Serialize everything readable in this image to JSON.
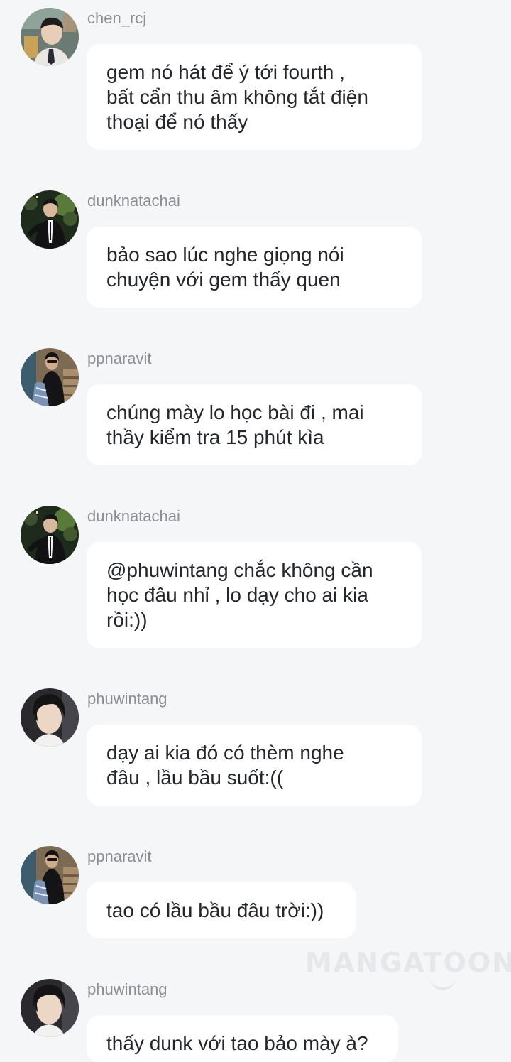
{
  "messages": [
    {
      "user": "chen_rcj",
      "text": "gem nó hát để ý tới fourth ,\nbất cẩn thu âm không tắt điện\nthoại để nó thấy",
      "avatar": "avatar-chen-icon"
    },
    {
      "user": "dunknatachai",
      "text": "bảo sao lúc nghe giọng nói\nchuyện với gem thấy quen",
      "avatar": "avatar-dunk-icon"
    },
    {
      "user": "ppnaravit",
      "text": "chúng mày lo học bài đi , mai\nthầy kiểm tra 15 phút kìa",
      "avatar": "avatar-pp-icon"
    },
    {
      "user": "dunknatachai",
      "text": "@phuwintang chắc không cần\nhọc đâu nhỉ , lo dạy cho ai kia\nrồi:))",
      "avatar": "avatar-dunk-icon"
    },
    {
      "user": "phuwintang",
      "text": "dạy ai kia đó có thèm nghe\nđâu , lầu bầu suốt:((",
      "avatar": "avatar-phuwin-icon"
    },
    {
      "user": "ppnaravit",
      "text": "tao có lầu bầu đâu trời:))",
      "avatar": "avatar-pp-icon"
    },
    {
      "user": "phuwintang",
      "text": "thấy dunk với tao bảo mày à?",
      "avatar": "avatar-phuwin-icon"
    }
  ],
  "watermark": "MANGATOON",
  "colors": {
    "background": "#f5f6f8",
    "bubble": "#ffffff",
    "username": "#8a8d93",
    "text": "#23262b"
  }
}
